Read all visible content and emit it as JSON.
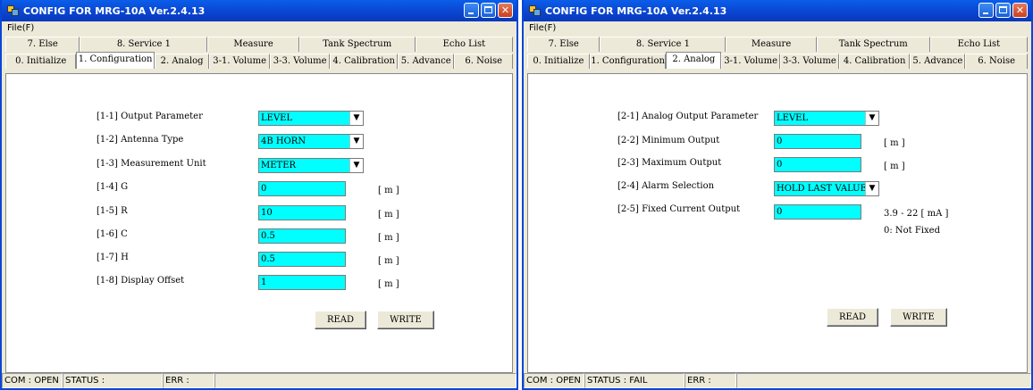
{
  "left": {
    "title": "CONFIG FOR MRG-10A Ver.2.4.13",
    "menu": "File(F)",
    "tabs_top": [
      "7. Else",
      "8. Service 1",
      "Measure",
      "Tank Spectrum",
      "Echo List"
    ],
    "tabs_bottom": [
      "0. Initialize",
      "1. Configuration",
      "2. Analog",
      "3-1. Volume",
      "3-3. Volume",
      "4. Calibration",
      "5. Advance",
      "6. Noise"
    ],
    "params": [
      {
        "label": "[1-1] Output Parameter",
        "value": "LEVEL",
        "unit": ""
      },
      {
        "label": "[1-2] Antenna Type",
        "value": "4B HORN",
        "unit": ""
      },
      {
        "label": "[1-3] Measurement Unit",
        "value": "METER",
        "unit": ""
      },
      {
        "label": "[1-4] G",
        "value": "0",
        "unit": "[ m ]"
      },
      {
        "label": "[1-5] R",
        "value": "10",
        "unit": "[ m ]"
      },
      {
        "label": "[1-6] C",
        "value": "0.5",
        "unit": "[ m ]"
      },
      {
        "label": "[1-7] H",
        "value": "0.5",
        "unit": "[ m ]"
      },
      {
        "label": "[1-8] Display Offset",
        "value": "1",
        "unit": "[ m ]"
      }
    ],
    "read_label": "READ",
    "write_label": "WRITE",
    "status": {
      "com": "COM : OPEN",
      "status": "STATUS :",
      "err": "ERR :"
    }
  },
  "right": {
    "title": "CONFIG FOR MRG-10A Ver.2.4.13",
    "menu": "File(F)",
    "tabs_top": [
      "7. Else",
      "8. Service 1",
      "Measure",
      "Tank Spectrum",
      "Echo List"
    ],
    "tabs_bottom": [
      "0. Initialize",
      "1. Configuration",
      "2. Analog",
      "3-1. Volume",
      "3-3. Volume",
      "4. Calibration",
      "5. Advance",
      "6. Noise"
    ],
    "params": [
      {
        "label": "[2-1] Analog Output Parameter",
        "value": "LEVEL",
        "unit": ""
      },
      {
        "label": "[2-2] Minimum Output",
        "value": "0",
        "unit": "[ m ]"
      },
      {
        "label": "[2-3] Maximum Output",
        "value": "0",
        "unit": "[ m ]"
      },
      {
        "label": "[2-4] Alarm Selection",
        "value": "HOLD LAST VALUE",
        "unit": ""
      },
      {
        "label": "[2-5] Fixed Current Output",
        "value": "0",
        "unit": "3.9 - 22 [ mA ]"
      }
    ],
    "note": "0: Not Fixed",
    "read_label": "READ",
    "write_label": "WRITE",
    "status": {
      "com": "COM : OPEN",
      "status": "STATUS : FAIL",
      "err": "ERR :"
    }
  },
  "colors": {
    "field": "#00ffff",
    "titlebar": "#0a47d4",
    "window": "#ece9d8"
  },
  "icons": {
    "app": "app-icon",
    "min": "minimize-icon",
    "max": "maximize-icon",
    "close": "close-icon",
    "dropdown": "dropdown-arrow-icon"
  }
}
